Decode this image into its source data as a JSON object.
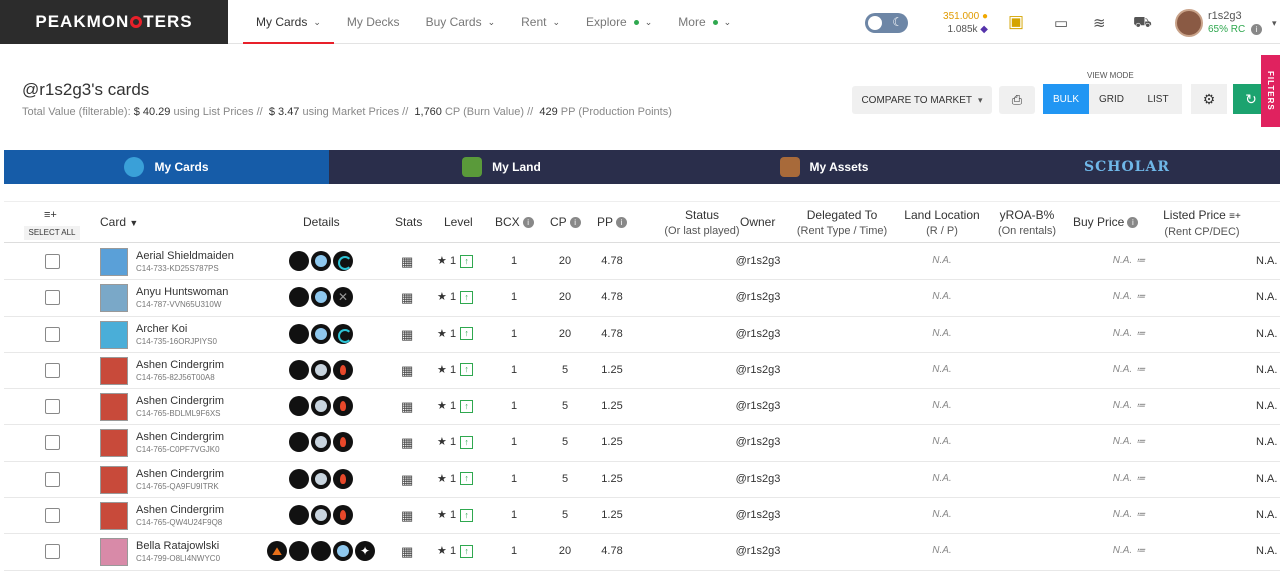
{
  "nav": {
    "logo_part1": "PEAKMON",
    "logo_part2": "TERS",
    "menu": [
      {
        "label": "My Cards",
        "chevron": true,
        "dot": false,
        "active": true
      },
      {
        "label": "My Decks",
        "chevron": false,
        "dot": false,
        "active": false
      },
      {
        "label": "Buy Cards",
        "chevron": true,
        "dot": false,
        "active": false
      },
      {
        "label": "Rent",
        "chevron": true,
        "dot": false,
        "active": false
      },
      {
        "label": "Explore",
        "chevron": true,
        "dot": true,
        "active": false
      },
      {
        "label": "More",
        "chevron": true,
        "dot": true,
        "active": false
      }
    ],
    "balance_top": "351.000",
    "balance_bottom": "1.085k",
    "username": "r1s2g3",
    "rc": "65% RC"
  },
  "header": {
    "title": "@r1s2g3's cards",
    "total_value_label": "Total Value (filterable):",
    "list_value": "$ 40.29",
    "list_label": "using List Prices //",
    "market_value": "$ 3.47",
    "market_label": "using Market Prices //",
    "cp_value": "1,760",
    "cp_label": "CP (Burn Value) //",
    "pp_value": "429",
    "pp_label": "PP (Production Points)",
    "compare_button": "COMPARE TO MARKET",
    "view_mode_label": "VIEW MODE",
    "view_modes": [
      "BULK",
      "GRID",
      "LIST"
    ],
    "filters_label": "FILTERS"
  },
  "tabs": [
    {
      "label": "My Cards",
      "color": "#3aa0d8"
    },
    {
      "label": "My Land",
      "color": "#5a9a3a"
    },
    {
      "label": "My Assets",
      "color": "#a86a3a"
    },
    {
      "label": "SCHOLAR",
      "color": "#6fb7e8"
    }
  ],
  "table": {
    "select_all": "SELECT ALL",
    "columns": {
      "card": "Card",
      "details": "Details",
      "stats": "Stats",
      "level": "Level",
      "bcx": "BCX",
      "cp": "CP",
      "pp": "PP",
      "status": "Status",
      "status_sub": "(Or last played)",
      "owner": "Owner",
      "delegated": "Delegated To",
      "delegated_sub": "(Rent Type / Time)",
      "land": "Land Location",
      "land_sub": "(R / P)",
      "yroa": "yROA-B%",
      "yroa_sub": "(On rentals)",
      "buy_price": "Buy Price",
      "listed_price": "Listed Price",
      "listed_sub": "(Rent CP/DEC)"
    },
    "rows": [
      {
        "name": "Aerial Shieldmaiden",
        "id": "C14-733-KD25S787PS",
        "dots": [
          "plain",
          "blue",
          "water"
        ],
        "thumb": "#5aa0d8",
        "level": "1",
        "bcx": "1",
        "cp": "20",
        "pp": "4.78",
        "owner": "@r1s2g3",
        "land": "N.A.",
        "buy": "N.A.",
        "listed": "N.A."
      },
      {
        "name": "Anyu Huntswoman",
        "id": "C14-787-VVN65U310W",
        "dots": [
          "plain",
          "blue",
          "death"
        ],
        "thumb": "#7aa8c8",
        "level": "1",
        "bcx": "1",
        "cp": "20",
        "pp": "4.78",
        "owner": "@r1s2g3",
        "land": "N.A.",
        "buy": "N.A.",
        "listed": "N.A."
      },
      {
        "name": "Archer Koi",
        "id": "C14-735-16ORJPIYS0",
        "dots": [
          "plain",
          "blue",
          "water"
        ],
        "thumb": "#4aaed8",
        "level": "1",
        "bcx": "1",
        "cp": "20",
        "pp": "4.78",
        "owner": "@r1s2g3",
        "land": "N.A.",
        "buy": "N.A.",
        "listed": "N.A."
      },
      {
        "name": "Ashen Cindergrim",
        "id": "C14-765-82J56T00A8",
        "dots": [
          "plain",
          "light",
          "fire"
        ],
        "thumb": "#c84a3a",
        "level": "1",
        "bcx": "1",
        "cp": "5",
        "pp": "1.25",
        "owner": "@r1s2g3",
        "land": "N.A.",
        "buy": "N.A.",
        "listed": "N.A."
      },
      {
        "name": "Ashen Cindergrim",
        "id": "C14-765-BDLML9F6XS",
        "dots": [
          "plain",
          "light",
          "fire"
        ],
        "thumb": "#c84a3a",
        "level": "1",
        "bcx": "1",
        "cp": "5",
        "pp": "1.25",
        "owner": "@r1s2g3",
        "land": "N.A.",
        "buy": "N.A.",
        "listed": "N.A."
      },
      {
        "name": "Ashen Cindergrim",
        "id": "C14-765-C0PF7VGJK0",
        "dots": [
          "plain",
          "light",
          "fire"
        ],
        "thumb": "#c84a3a",
        "level": "1",
        "bcx": "1",
        "cp": "5",
        "pp": "1.25",
        "owner": "@r1s2g3",
        "land": "N.A.",
        "buy": "N.A.",
        "listed": "N.A."
      },
      {
        "name": "Ashen Cindergrim",
        "id": "C14-765-QA9FU9ITRK",
        "dots": [
          "plain",
          "light",
          "fire"
        ],
        "thumb": "#c84a3a",
        "level": "1",
        "bcx": "1",
        "cp": "5",
        "pp": "1.25",
        "owner": "@r1s2g3",
        "land": "N.A.",
        "buy": "N.A.",
        "listed": "N.A."
      },
      {
        "name": "Ashen Cindergrim",
        "id": "C14-765-QW4U24F9Q8",
        "dots": [
          "plain",
          "light",
          "fire"
        ],
        "thumb": "#c84a3a",
        "level": "1",
        "bcx": "1",
        "cp": "5",
        "pp": "1.25",
        "owner": "@r1s2g3",
        "land": "N.A.",
        "buy": "N.A.",
        "listed": "N.A."
      },
      {
        "name": "Bella Ratajowlski",
        "id": "C14-799-O8LI4NWYC0",
        "dots": [
          "drag",
          "plain",
          "plain",
          "blue",
          "star"
        ],
        "thumb": "#d88aa8",
        "level": "1",
        "bcx": "1",
        "cp": "20",
        "pp": "4.78",
        "owner": "@r1s2g3",
        "land": "N.A.",
        "buy": "N.A.",
        "listed": "N.A."
      }
    ]
  }
}
